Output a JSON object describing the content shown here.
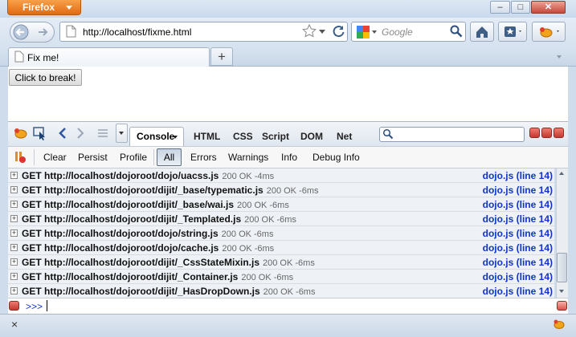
{
  "browser": {
    "menu_button_label": "Firefox",
    "url": "http://localhost/fixme.html",
    "search_placeholder": "Google"
  },
  "tabs": [
    {
      "label": "Fix me!"
    }
  ],
  "page": {
    "button_label": "Click to break!"
  },
  "firebug": {
    "panel_tabs": [
      "Console",
      "HTML",
      "CSS",
      "Script",
      "DOM",
      "Net"
    ],
    "console_toolbar": [
      "Clear",
      "Persist",
      "Profile",
      "All",
      "Errors",
      "Warnings",
      "Info",
      "Debug Info"
    ],
    "log": [
      {
        "request": "GET http://localhost/dojoroot/dojo/uacss.js",
        "status": "200 OK -4ms",
        "source": "dojo.js (line 14)"
      },
      {
        "request": "GET http://localhost/dojoroot/dijit/_base/typematic.js",
        "status": "200 OK -6ms",
        "source": "dojo.js (line 14)"
      },
      {
        "request": "GET http://localhost/dojoroot/dijit/_base/wai.js",
        "status": "200 OK -6ms",
        "source": "dojo.js (line 14)"
      },
      {
        "request": "GET http://localhost/dojoroot/dijit/_Templated.js",
        "status": "200 OK -6ms",
        "source": "dojo.js (line 14)"
      },
      {
        "request": "GET http://localhost/dojoroot/dojo/string.js",
        "status": "200 OK -6ms",
        "source": "dojo.js (line 14)"
      },
      {
        "request": "GET http://localhost/dojoroot/dojo/cache.js",
        "status": "200 OK -6ms",
        "source": "dojo.js (line 14)"
      },
      {
        "request": "GET http://localhost/dojoroot/dijit/_CssStateMixin.js",
        "status": "200 OK -6ms",
        "source": "dojo.js (line 14)"
      },
      {
        "request": "GET http://localhost/dojoroot/dijit/_Container.js",
        "status": "200 OK -6ms",
        "source": "dojo.js (line 14)"
      },
      {
        "request": "GET http://localhost/dojoroot/dijit/_HasDropDown.js",
        "status": "200 OK -6ms",
        "source": "dojo.js (line 14)"
      }
    ],
    "prompt": ">>>"
  },
  "colors": {
    "accent_orange": "#e16a13",
    "link_blue": "#1034c8"
  },
  "icons": [
    "back-icon",
    "forward-icon",
    "page-icon",
    "star-icon",
    "reload-icon",
    "google-icon",
    "search-icon",
    "home-icon",
    "bookmarks-icon",
    "firebug-icon",
    "inspect-icon",
    "close-icon"
  ]
}
